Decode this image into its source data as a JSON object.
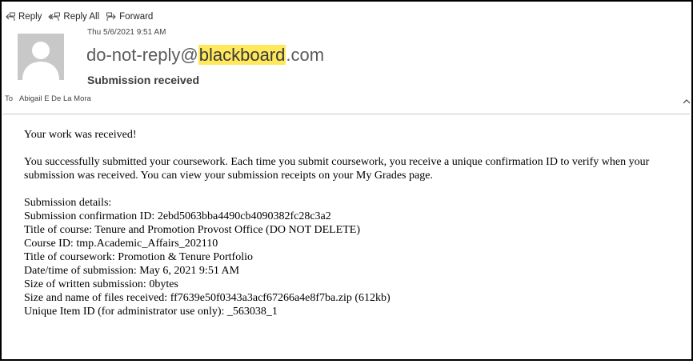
{
  "toolbar": {
    "reply_label": "Reply",
    "reply_all_label": "Reply All",
    "forward_label": "Forward"
  },
  "message": {
    "date": "Thu 5/6/2021 9:51 AM",
    "sender_prefix": "do-not-reply@",
    "sender_highlight": "blackboard",
    "sender_suffix": ".com",
    "subject": "Submission received",
    "to_label": "To",
    "recipient": "Abigail E De La Mora"
  },
  "body": {
    "greeting": "Your work was received!",
    "paragraph": "You successfully submitted your coursework. Each time you submit coursework, you receive a unique confirmation ID to verify when your submission was received. You can view your submission receipts on your My Grades page.",
    "details": [
      "Submission details:",
      "Submission confirmation ID: 2ebd5063bba4490cb4090382fc28c3a2",
      "Title of course: Tenure and Promotion Provost Office (DO NOT DELETE)",
      "Course ID: tmp.Academic_Affairs_202110",
      "Title of coursework: Promotion & Tenure Portfolio",
      "Date/time of submission: May 6, 2021 9:51 AM",
      "Size of written submission: 0bytes",
      "Size and name of files received: ff7639e50f0343a3acf67266a4e8f7ba.zip (612kb)",
      "Unique Item ID (for administrator use only): _563038_1"
    ]
  },
  "colors": {
    "highlight": "#ffe85c",
    "avatar_bg": "#c8c8c8",
    "avatar_fg": "#ffffff",
    "border": "#000000"
  },
  "icons": {
    "reply": "reply-icon",
    "reply_all": "reply-all-icon",
    "forward": "forward-icon",
    "avatar": "default-person-avatar",
    "collapse": "chevron-up-icon"
  }
}
